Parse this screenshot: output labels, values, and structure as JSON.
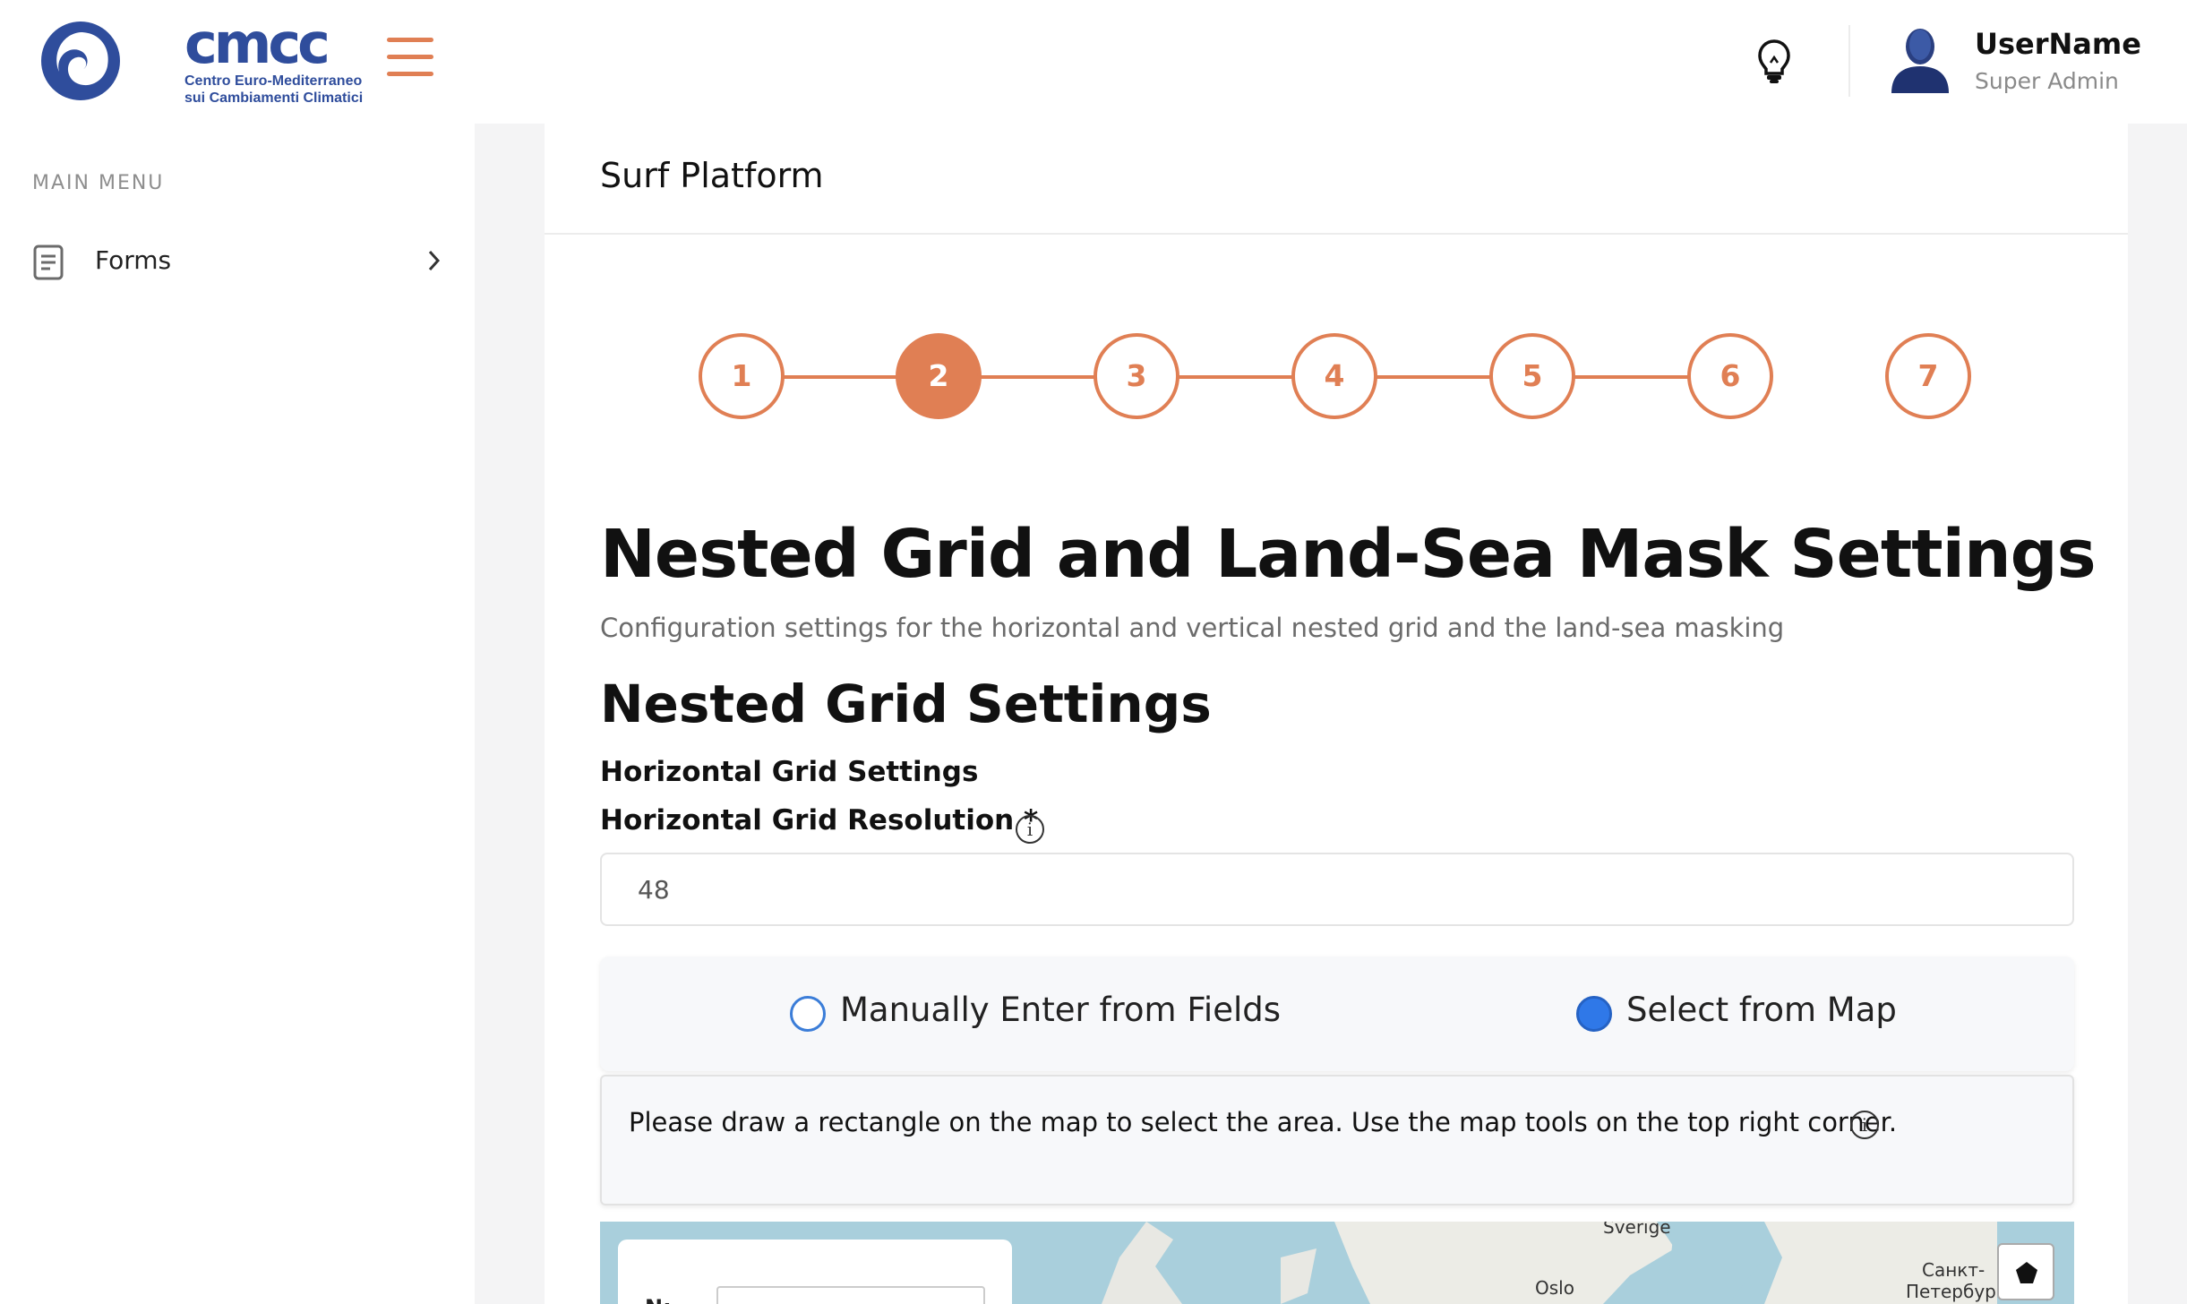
{
  "brand": {
    "logo_word": "cmcc",
    "logo_sub_1": "Centro Euro-Mediterraneo",
    "logo_sub_2": "sui Cambiamenti Climatici",
    "accent": "#e07f54",
    "brand_blue": "#2f4d9c"
  },
  "header": {
    "hamburger_icon": "hamburger-icon",
    "bulb_icon": "lightbulb-icon",
    "user": {
      "name": "UserName",
      "role": "Super Admin",
      "avatar_icon": "user-avatar-icon"
    }
  },
  "sidebar": {
    "title": "MAIN MENU",
    "items": [
      {
        "label": "Forms",
        "icon": "document-icon",
        "chevron": "chevron-right-icon"
      }
    ]
  },
  "main": {
    "title": "Surf Platform",
    "stepper": {
      "steps": [
        "1",
        "2",
        "3",
        "4",
        "5",
        "6",
        "7"
      ],
      "active": 2
    },
    "heading": "Nested Grid and Land-Sea Mask Settings",
    "description": "Configuration settings for the horizontal and vertical nested grid and the land-sea masking",
    "section": "Nested Grid Settings",
    "subsection": "Horizontal Grid Settings",
    "resolution_label": "Horizontal Grid Resolution *",
    "resolution_value": "48",
    "info_icon": "i",
    "radio": {
      "options": [
        {
          "label": "Manually Enter from Fields",
          "checked": false
        },
        {
          "label": "Select from Map",
          "checked": true
        }
      ]
    },
    "note": "Please draw a rectangle on the map to select the area. Use the map tools on the top right corner.",
    "map": {
      "n_label": "N:",
      "places": [
        "Sverige",
        "Oslo",
        "Санкт-",
        "Петербург"
      ],
      "tool_icon": "polygon-draw-icon"
    }
  }
}
